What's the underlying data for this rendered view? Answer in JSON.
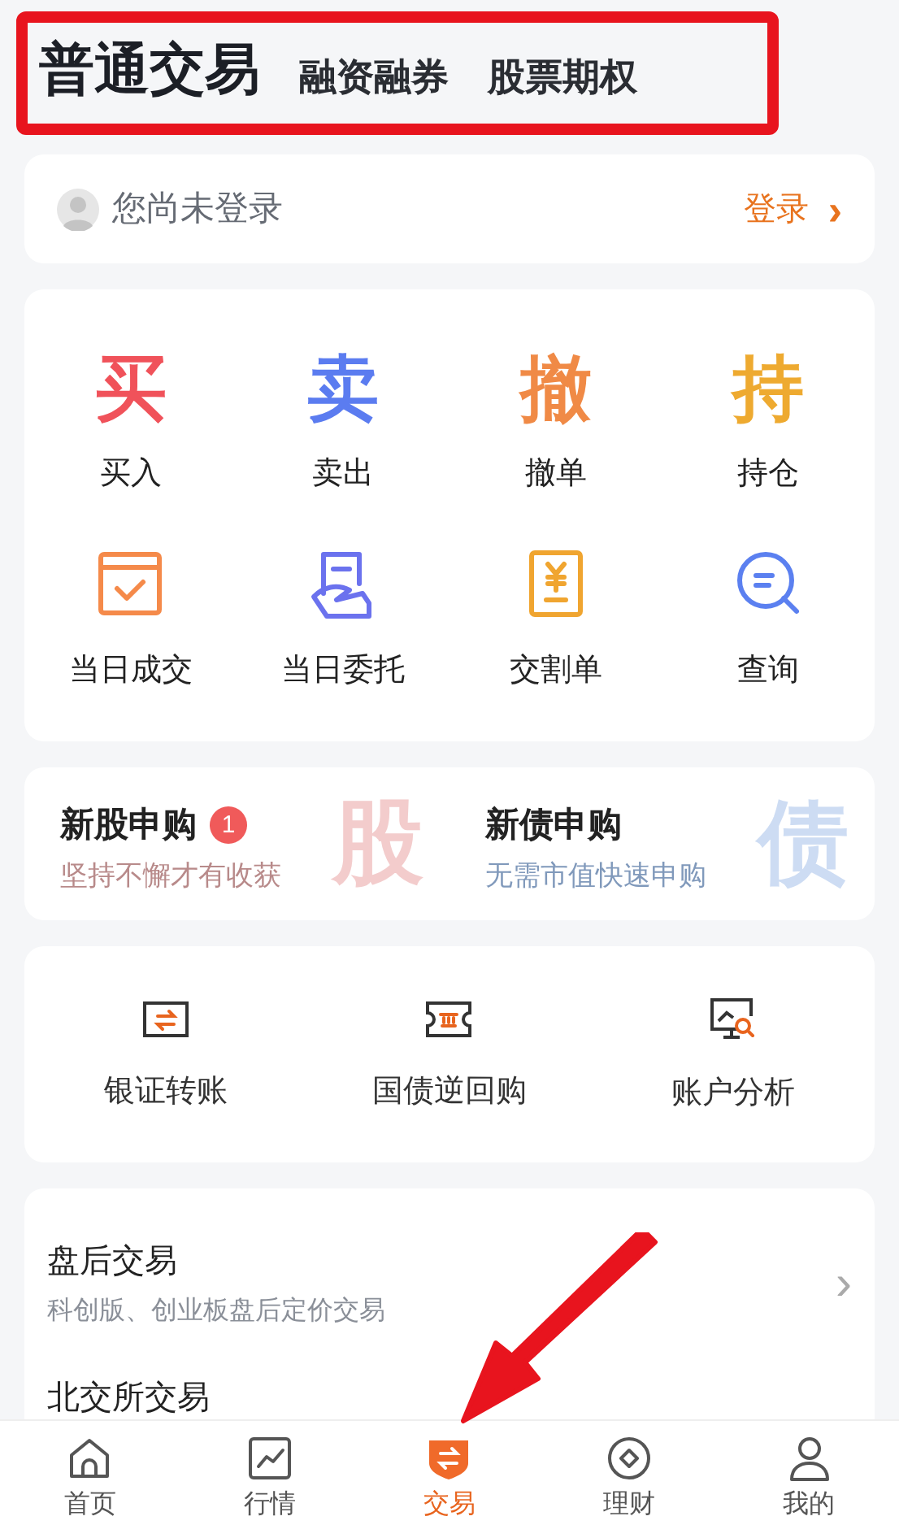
{
  "tabs": [
    {
      "label": "普通交易",
      "selected": true
    },
    {
      "label": "融资融券",
      "selected": false
    },
    {
      "label": "股票期权",
      "selected": false
    }
  ],
  "login": {
    "status": "您尚未登录",
    "action": "登录",
    "arrow": "›"
  },
  "quick_actions": [
    {
      "glyph": "买",
      "label": "买入",
      "color": "#f0525a"
    },
    {
      "glyph": "卖",
      "label": "卖出",
      "color": "#5b7cf0"
    },
    {
      "glyph": "撤",
      "label": "撤单",
      "color": "#f08a46"
    },
    {
      "glyph": "持",
      "label": "持仓",
      "color": "#eeaa30"
    }
  ],
  "tools": [
    {
      "kind": "calendar",
      "label": "当日成交",
      "color": "#f58a4a"
    },
    {
      "kind": "receipt",
      "label": "当日委托",
      "color": "#6b72ee"
    },
    {
      "kind": "bill",
      "label": "交割单",
      "color": "#f0a530"
    },
    {
      "kind": "search",
      "label": "查询",
      "color": "#5b80f0"
    }
  ],
  "subscriptions": [
    {
      "title": "新股申购",
      "badge": "1",
      "subtitle": "坚持不懈才有收获",
      "mark": "股",
      "color": "#b88a8a"
    },
    {
      "title": "新债申购",
      "subtitle": "无需市值快速申购",
      "mark": "债",
      "color": "#8099bb"
    }
  ],
  "services": [
    {
      "kind": "transfer",
      "label": "银证转账"
    },
    {
      "kind": "bond",
      "label": "国债逆回购"
    },
    {
      "kind": "analysis",
      "label": "账户分析"
    }
  ],
  "list": [
    {
      "title": "盘后交易",
      "subtitle": "科创版、创业板盘后定价交易",
      "arrow": "›"
    },
    {
      "title": "北交所交易"
    }
  ],
  "nav": [
    {
      "kind": "home",
      "label": "首页",
      "selected": false
    },
    {
      "kind": "chart",
      "label": "行情",
      "selected": false
    },
    {
      "kind": "trade",
      "label": "交易",
      "selected": true
    },
    {
      "kind": "wealth",
      "label": "理财",
      "selected": false
    },
    {
      "kind": "user",
      "label": "我的",
      "selected": false
    }
  ]
}
